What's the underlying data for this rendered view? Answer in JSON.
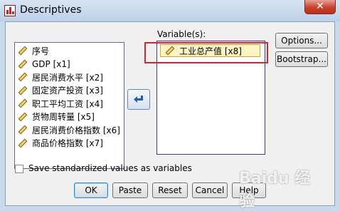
{
  "window": {
    "title": "Descriptives",
    "close_label": "✕"
  },
  "source_list": {
    "items": [
      {
        "label": "序号"
      },
      {
        "label": "GDP [x1]"
      },
      {
        "label": "居民消费水平 [x2]"
      },
      {
        "label": "固定资产投资 [x3]"
      },
      {
        "label": "职工平均工资 [x4]"
      },
      {
        "label": "货物周转量 [x5]"
      },
      {
        "label": "居民消费价格指数 [x6]"
      },
      {
        "label": "商品价格指数 [x7]"
      }
    ]
  },
  "target": {
    "label": "Variable(s):",
    "items": [
      {
        "label": "工业总产值 [x8]"
      }
    ]
  },
  "side_buttons": {
    "options": "Options...",
    "bootstrap": "Bootstrap..."
  },
  "checkbox": {
    "label": "Save standardized values as variables",
    "checked": false
  },
  "bottom_buttons": {
    "ok": "OK",
    "paste": "Paste",
    "reset": "Reset",
    "cancel": "Cancel",
    "help": "Help"
  },
  "watermark": "Baidu 经验",
  "colors": {
    "highlight": "#d0262f",
    "selected_bg": "#fdf3c4"
  }
}
